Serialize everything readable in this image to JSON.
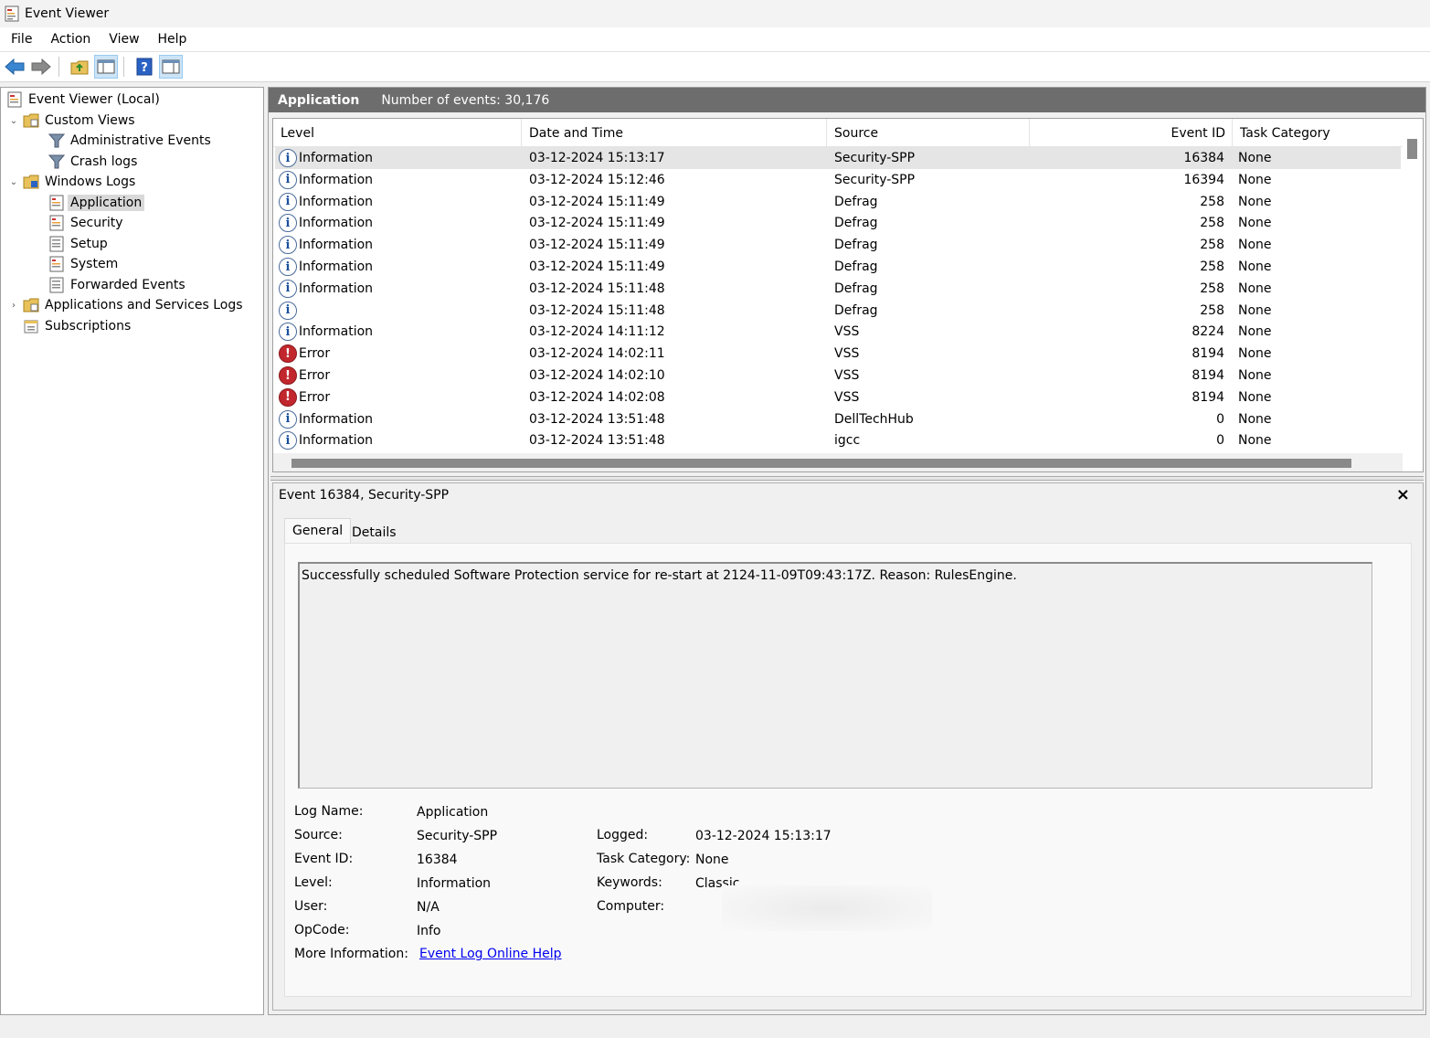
{
  "window": {
    "title": "Event Viewer"
  },
  "menu": [
    "File",
    "Action",
    "View",
    "Help"
  ],
  "tree": {
    "root": "Event Viewer (Local)",
    "custom_views": "Custom Views",
    "administrative_events": "Administrative Events",
    "crash_logs": "Crash logs",
    "windows_logs": "Windows Logs",
    "application": "Application",
    "security": "Security",
    "setup": "Setup",
    "system": "System",
    "forwarded_events": "Forwarded Events",
    "apps_services_logs": "Applications and Services Logs",
    "subscriptions": "Subscriptions"
  },
  "header": {
    "log_name": "Application",
    "count": "Number of events: 30,176"
  },
  "columns": [
    "Level",
    "Date and Time",
    "Source",
    "Event ID",
    "Task Category"
  ],
  "events": [
    {
      "level": "Information",
      "icon": "info-icon",
      "datetime": "03-12-2024 15:13:17",
      "source": "Security-SPP",
      "event_id": "16384",
      "category": "None"
    },
    {
      "level": "Information",
      "icon": "info-icon",
      "datetime": "03-12-2024 15:12:46",
      "source": "Security-SPP",
      "event_id": "16394",
      "category": "None"
    },
    {
      "level": "Information",
      "icon": "info-icon",
      "datetime": "03-12-2024 15:11:49",
      "source": "Defrag",
      "event_id": "258",
      "category": "None"
    },
    {
      "level": "Information",
      "icon": "info-icon",
      "datetime": "03-12-2024 15:11:49",
      "source": "Defrag",
      "event_id": "258",
      "category": "None"
    },
    {
      "level": "Information",
      "icon": "info-icon",
      "datetime": "03-12-2024 15:11:49",
      "source": "Defrag",
      "event_id": "258",
      "category": "None"
    },
    {
      "level": "Information",
      "icon": "info-icon",
      "datetime": "03-12-2024 15:11:49",
      "source": "Defrag",
      "event_id": "258",
      "category": "None"
    },
    {
      "level": "Information",
      "icon": "info-icon",
      "datetime": "03-12-2024 15:11:48",
      "source": "Defrag",
      "event_id": "258",
      "category": "None"
    },
    {
      "level": "",
      "icon": "info-icon",
      "datetime": "03-12-2024 15:11:48",
      "source": "Defrag",
      "event_id": "258",
      "category": "None"
    },
    {
      "level": "Information",
      "icon": "info-icon",
      "datetime": "03-12-2024 14:11:12",
      "source": "VSS",
      "event_id": "8224",
      "category": "None"
    },
    {
      "level": "Error",
      "icon": "error-icon",
      "datetime": "03-12-2024 14:02:11",
      "source": "VSS",
      "event_id": "8194",
      "category": "None"
    },
    {
      "level": "Error",
      "icon": "error-icon",
      "datetime": "03-12-2024 14:02:10",
      "source": "VSS",
      "event_id": "8194",
      "category": "None"
    },
    {
      "level": "Error",
      "icon": "error-icon",
      "datetime": "03-12-2024 14:02:08",
      "source": "VSS",
      "event_id": "8194",
      "category": "None"
    },
    {
      "level": "Information",
      "icon": "info-icon",
      "datetime": "03-12-2024 13:51:48",
      "source": "DellTechHub",
      "event_id": "0",
      "category": "None"
    },
    {
      "level": "Information",
      "icon": "info-icon",
      "datetime": "03-12-2024 13:51:48",
      "source": "igcc",
      "event_id": "0",
      "category": "None"
    }
  ],
  "detail": {
    "title": "Event 16384, Security-SPP",
    "close": "×",
    "tabs": [
      "General",
      "Details"
    ],
    "message": "Successfully scheduled Software Protection service for re-start at 2124-11-09T09:43:17Z. Reason: RulesEngine.",
    "labels": {
      "log_name": "Log Name:",
      "source": "Source:",
      "event_id": "Event ID:",
      "level": "Level:",
      "user": "User:",
      "opcode": "OpCode:",
      "more_info": "More Information:",
      "logged": "Logged:",
      "task_category": "Task Category:",
      "keywords": "Keywords:",
      "computer": "Computer:"
    },
    "values": {
      "log_name": "Application",
      "source": "Security-SPP",
      "event_id": "16384",
      "level": "Information",
      "user": "N/A",
      "opcode": "Info",
      "more_info": "Event Log Online Help",
      "logged": "03-12-2024 15:13:17",
      "task_category": "None",
      "keywords": "Classic",
      "computer": ""
    }
  }
}
